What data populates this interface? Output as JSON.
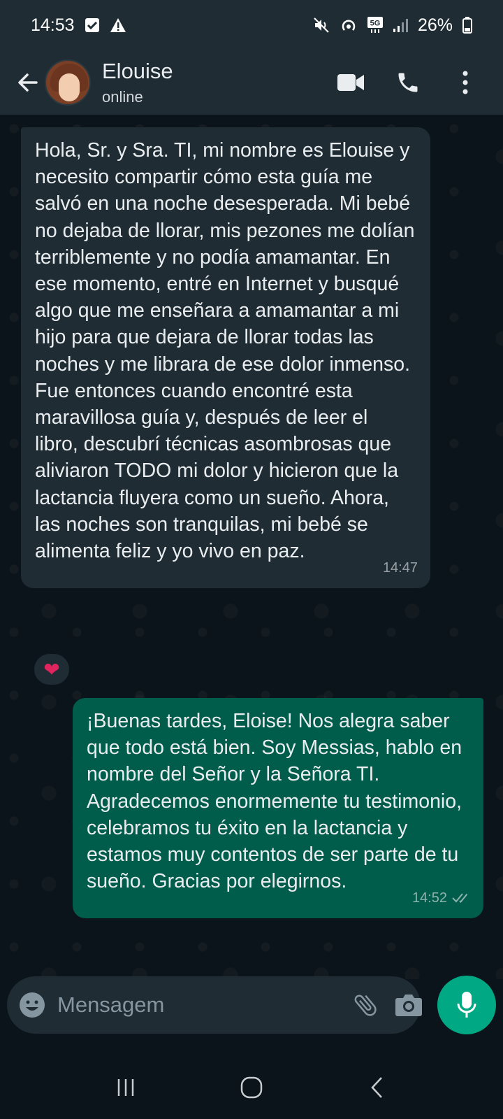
{
  "status_bar": {
    "time": "14:53",
    "battery": "26%",
    "network": "5G"
  },
  "header": {
    "contact_name": "Elouise",
    "contact_status": "online"
  },
  "messages": [
    {
      "direction": "incoming",
      "text": "Hola, Sr. y Sra. TI, mi nombre es Elouise y necesito compartir cómo esta guía me salvó en una noche desesperada. Mi bebé no dejaba de llorar, mis pezones me dolían terriblemente y no podía amamantar. En ese momento, entré en Internet y busqué algo que me enseñara a amamantar a mi hijo para que dejara de llorar todas las noches y me librara de ese dolor inmenso. Fue entonces cuando encontré esta maravillosa guía y, después de leer el libro, descubrí técnicas asombrosas que aliviaron TODO mi dolor y hicieron que la lactancia fluyera como un sueño. Ahora, las noches son tranquilas, mi bebé se alimenta feliz y yo vivo en paz.",
      "time": "14:47",
      "reaction": "❤"
    },
    {
      "direction": "outgoing",
      "text": "¡Buenas tardes, Eloise! Nos alegra saber que todo está bien. Soy Messias, hablo en nombre del Señor y la Señora TI. Agradecemos enormemente tu testimonio, celebramos tu éxito en la lactancia y estamos muy contentos de ser parte de tu sueño. Gracias por elegirnos.",
      "time": "14:52",
      "read_status": "read"
    }
  ],
  "composer": {
    "placeholder": "Mensagem"
  },
  "colors": {
    "header_bg": "#1f2c34",
    "chat_bg": "#0b141a",
    "incoming_bubble": "#1f2c34",
    "outgoing_bubble": "#005c4b",
    "accent": "#00a884"
  }
}
